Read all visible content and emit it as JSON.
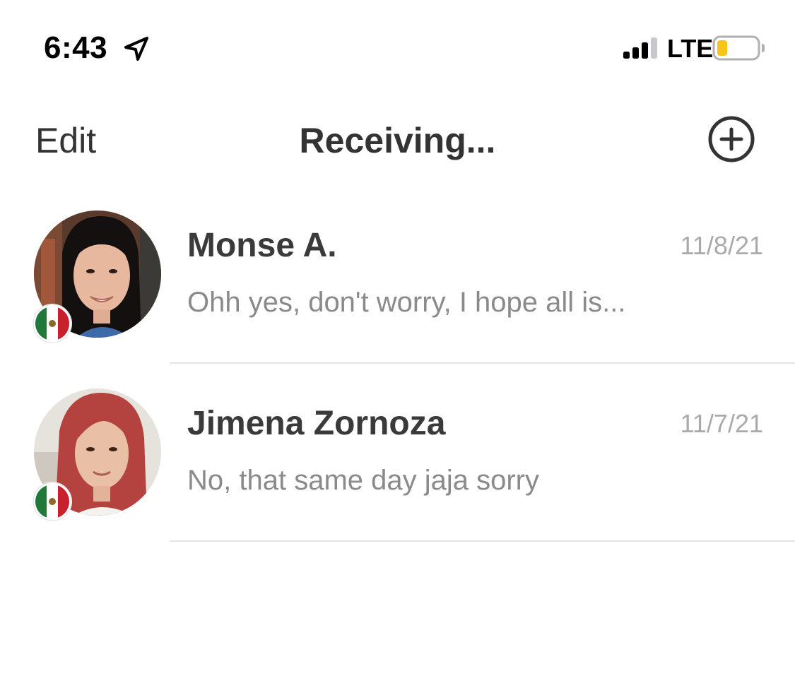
{
  "status_bar": {
    "time": "6:43",
    "network": "LTE",
    "signal_bars_filled": 3,
    "signal_bars_total": 4,
    "battery_color": "#f5c518",
    "icons": [
      "location-arrow-icon",
      "signal-strength-icon",
      "battery-icon"
    ]
  },
  "nav": {
    "edit_label": "Edit",
    "title": "Receiving...",
    "new_icon": "plus-circle-icon"
  },
  "conversations": [
    {
      "name": "Monse A.",
      "date": "11/8/21",
      "preview": "Ohh yes, don't worry, I hope all is...",
      "flag": "mexico-flag-icon"
    },
    {
      "name": "Jimena Zornoza",
      "date": "11/7/21",
      "preview": "No, that same day jaja sorry",
      "flag": "mexico-flag-icon"
    }
  ],
  "colors": {
    "text_primary": "#3a3a3a",
    "text_secondary": "#8a8a8a",
    "date": "#aaaaaa",
    "divider": "#e4e4e4"
  }
}
